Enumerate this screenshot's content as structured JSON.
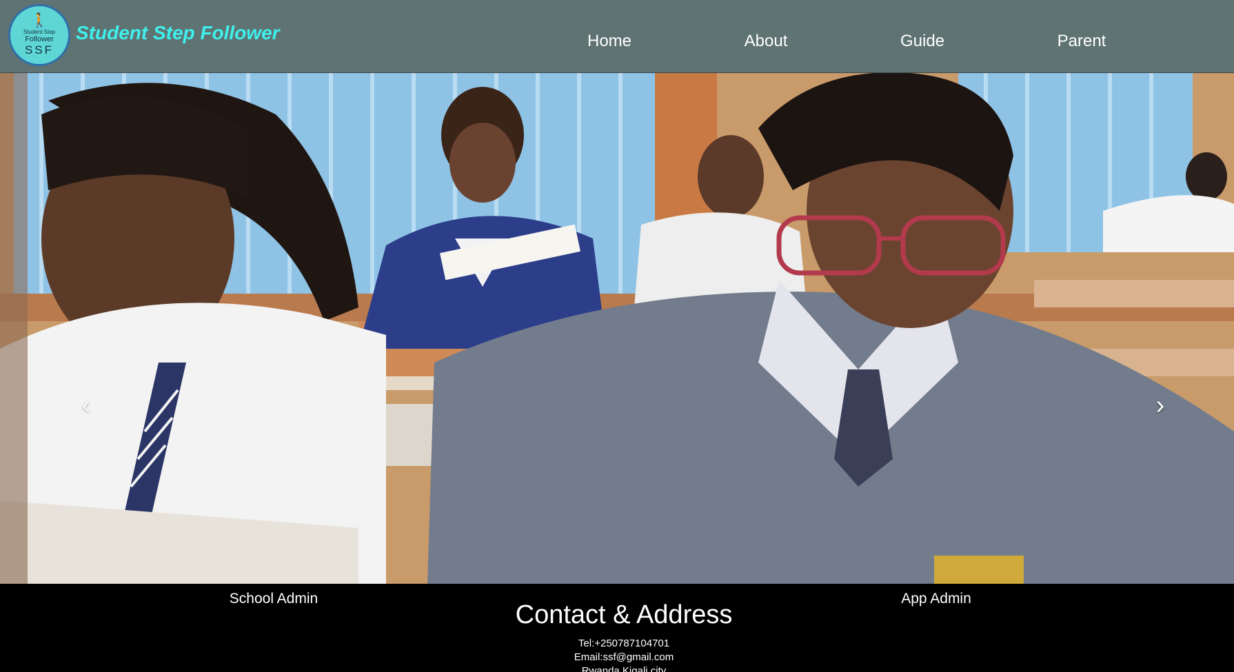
{
  "header": {
    "brand": "Student Step Follower",
    "logo": {
      "line1": "Student Step",
      "line2": "Follower",
      "line3": "SSF"
    },
    "nav": [
      {
        "label": "Home"
      },
      {
        "label": "About"
      },
      {
        "label": "Guide"
      },
      {
        "label": "Parent"
      }
    ]
  },
  "carousel": {
    "prev_icon": "chevron-left-icon",
    "next_icon": "chevron-right-icon",
    "slide_count": 3,
    "active_slide": 1
  },
  "footer": {
    "school_admin": "School Admin",
    "app_admin": "App Admin",
    "title": "Contact & Address",
    "tel": "Tel:+250787104701",
    "email": "Email:ssf@gmail.com",
    "address": "Rwanda Kigali city"
  },
  "colors": {
    "header_bg": "#5f7373",
    "brand": "#3ff0ec",
    "footer_bg": "#000000"
  }
}
